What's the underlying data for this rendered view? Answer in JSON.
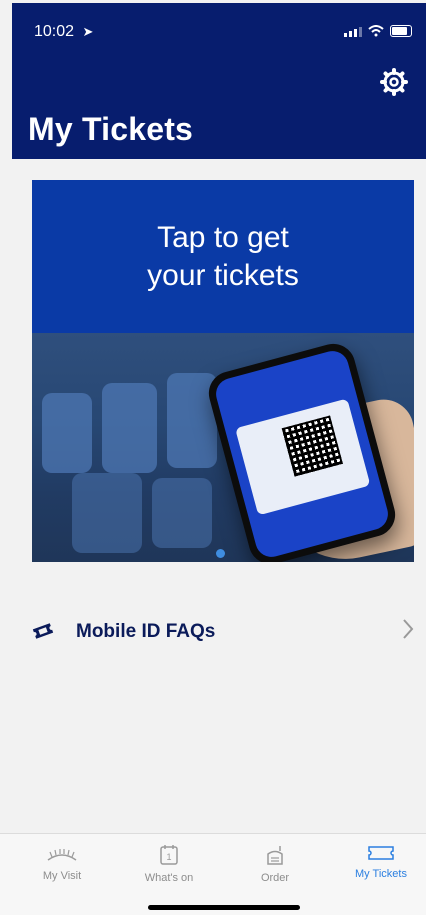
{
  "status_bar": {
    "time": "10:02"
  },
  "header": {
    "title": "My Tickets"
  },
  "banner": {
    "text_line1": "Tap to get",
    "text_line2": "your tickets"
  },
  "faq": {
    "label": "Mobile ID FAQs"
  },
  "tabs": [
    {
      "label": "My Visit",
      "icon": "stadium-icon",
      "active": false
    },
    {
      "label": "What's on",
      "icon": "calendar-icon",
      "active": false
    },
    {
      "label": "Order",
      "icon": "order-icon",
      "active": false
    },
    {
      "label": "My Tickets",
      "icon": "ticket-icon",
      "active": true
    }
  ],
  "colors": {
    "header_bg": "#071d6e",
    "banner_bg": "#0a3aa6",
    "active_tab": "#2b7fe0",
    "text_dark": "#0b1b5a"
  }
}
